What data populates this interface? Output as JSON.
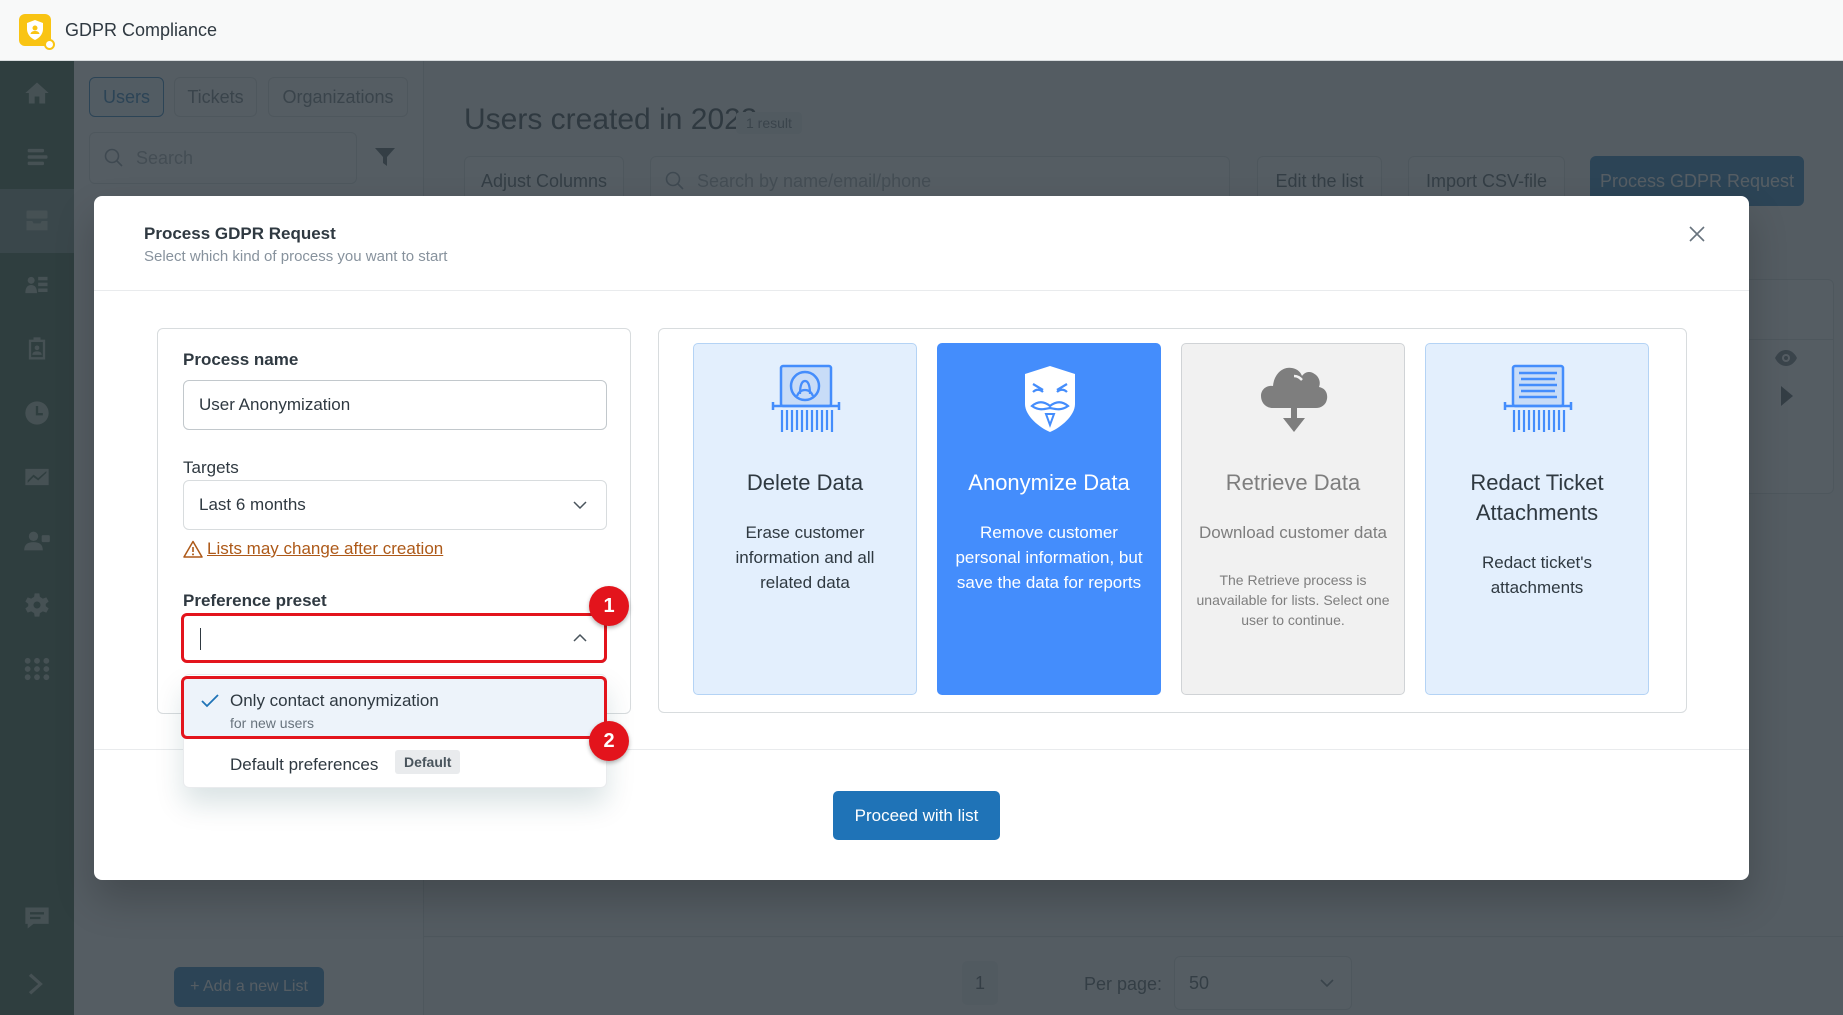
{
  "app": {
    "title": "GDPR Compliance",
    "brand_color": "#f9c413"
  },
  "sidebar": {
    "items": [
      {
        "icon": "home-icon"
      },
      {
        "icon": "lists-icon"
      },
      {
        "icon": "inbox-icon",
        "active": true
      },
      {
        "icon": "contacts-icon"
      },
      {
        "icon": "clipboard-user-icon"
      },
      {
        "icon": "clock-icon"
      },
      {
        "icon": "chart-icon"
      },
      {
        "icon": "user-lock-icon"
      },
      {
        "icon": "gear-icon"
      },
      {
        "icon": "apps-grid-icon"
      }
    ],
    "bottom": [
      {
        "icon": "chat-icon"
      },
      {
        "icon": "chevron-right-icon"
      }
    ]
  },
  "background": {
    "tabs": [
      "Users",
      "Tickets",
      "Organizations"
    ],
    "search_placeholder": "Search",
    "page_title": "Users created in 2023",
    "result_badge": "1 result",
    "buttons": {
      "adjust_columns": "Adjust Columns",
      "edit_list": "Edit the list",
      "import_csv": "Import CSV-file",
      "process_gdpr": "Process GDPR Request"
    },
    "table_search_placeholder": "Search by name/email/phone",
    "add_list": "+ Add a new List",
    "pagination": {
      "current_page": "1",
      "per_page_label": "Per page:",
      "per_page_value": "50"
    }
  },
  "modal": {
    "title": "Process GDPR Request",
    "subtitle": "Select which kind of process you want to start",
    "form": {
      "process_name_label": "Process name",
      "process_name_value": "User Anonymization",
      "targets_label": "Targets",
      "targets_value": "Last 6 months",
      "warning_text": "Lists may change after creation",
      "preset_label": "Preference preset",
      "preset_value": "",
      "preset_options": [
        {
          "label": "Only contact anonymization",
          "sublabel": "for new users",
          "checked": true
        },
        {
          "label": "Default preferences",
          "tag": "Default",
          "checked": false
        }
      ]
    },
    "cards": [
      {
        "title": "Delete Data",
        "description": "Erase customer information and all related data",
        "state": "available",
        "icon": "shredder-user-icon"
      },
      {
        "title": "Anonymize Data",
        "description": "Remove customer personal information, but save the data for reports",
        "state": "selected",
        "icon": "anonymous-mask-icon"
      },
      {
        "title": "Retrieve Data",
        "description": "Download customer data",
        "note": "The Retrieve process is unavailable for lists. Select one user to continue.",
        "state": "disabled",
        "icon": "cloud-download-icon"
      },
      {
        "title": "Redact Ticket Attachments",
        "description": "Redact ticket's attachments",
        "state": "available",
        "icon": "shredder-document-icon"
      }
    ],
    "proceed_label": "Proceed with list"
  },
  "annotations": [
    {
      "number": "1",
      "target": "preference-preset-input"
    },
    {
      "number": "2",
      "target": "preset-option-only-contact"
    }
  ],
  "colors": {
    "primary": "#1f73b7",
    "card_selected": "#448dfc",
    "card_available": "#e3effd",
    "card_disabled": "#f1f1f1",
    "warning": "#ad5918",
    "annotation": "#e3141c"
  }
}
